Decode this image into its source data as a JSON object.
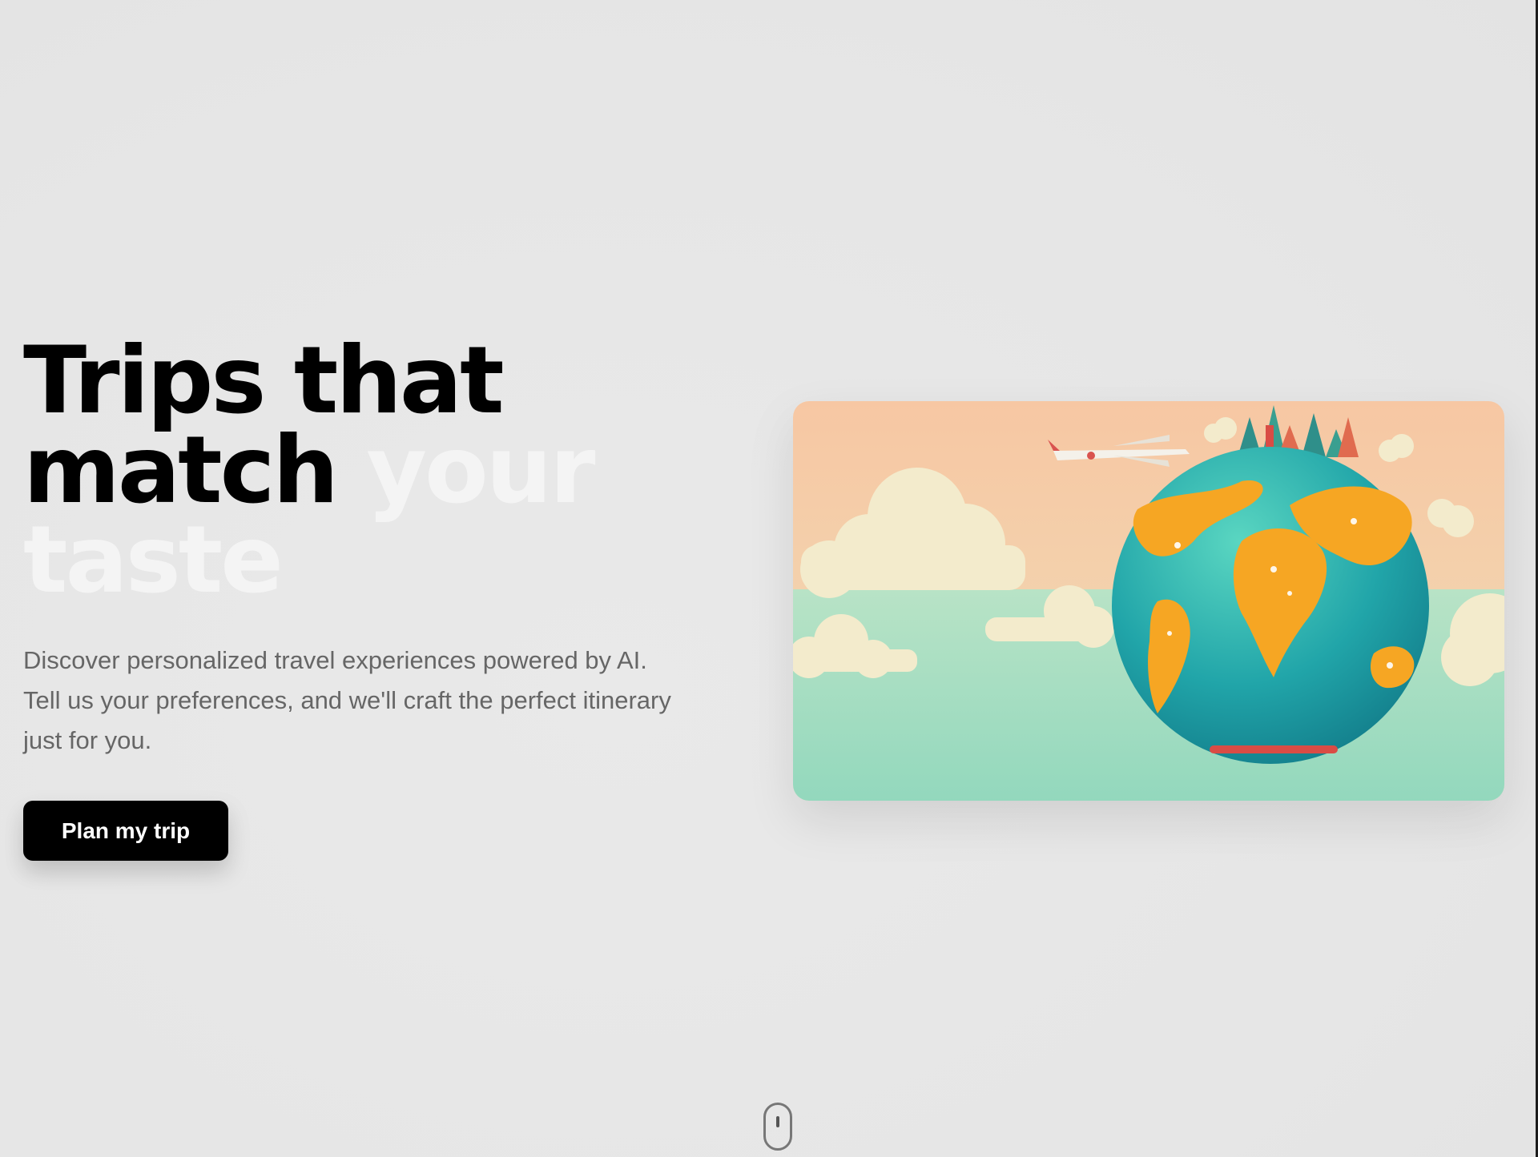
{
  "hero": {
    "headline_line1": "Trips that",
    "headline_line2_dark": "match ",
    "headline_line2_faded": "your",
    "headline_line3_faded": "taste",
    "subtext_line1": "Discover personalized travel experiences powered by AI.",
    "subtext_line2": "Tell us your preferences, and we'll craft the perfect itinerary",
    "subtext_line3": "just for you.",
    "cta_label": "Plan my trip"
  },
  "illustration": {
    "subject": "globe-with-landmarks-and-airplane",
    "colors": {
      "sky": "#f7cba6",
      "sea": "#9fdcc0",
      "ocean": "#2fb0b0",
      "land": "#f5a623",
      "cloud": "#f3ecd0"
    }
  },
  "icons": {
    "scroll_indicator": "mouse-scroll-icon"
  }
}
